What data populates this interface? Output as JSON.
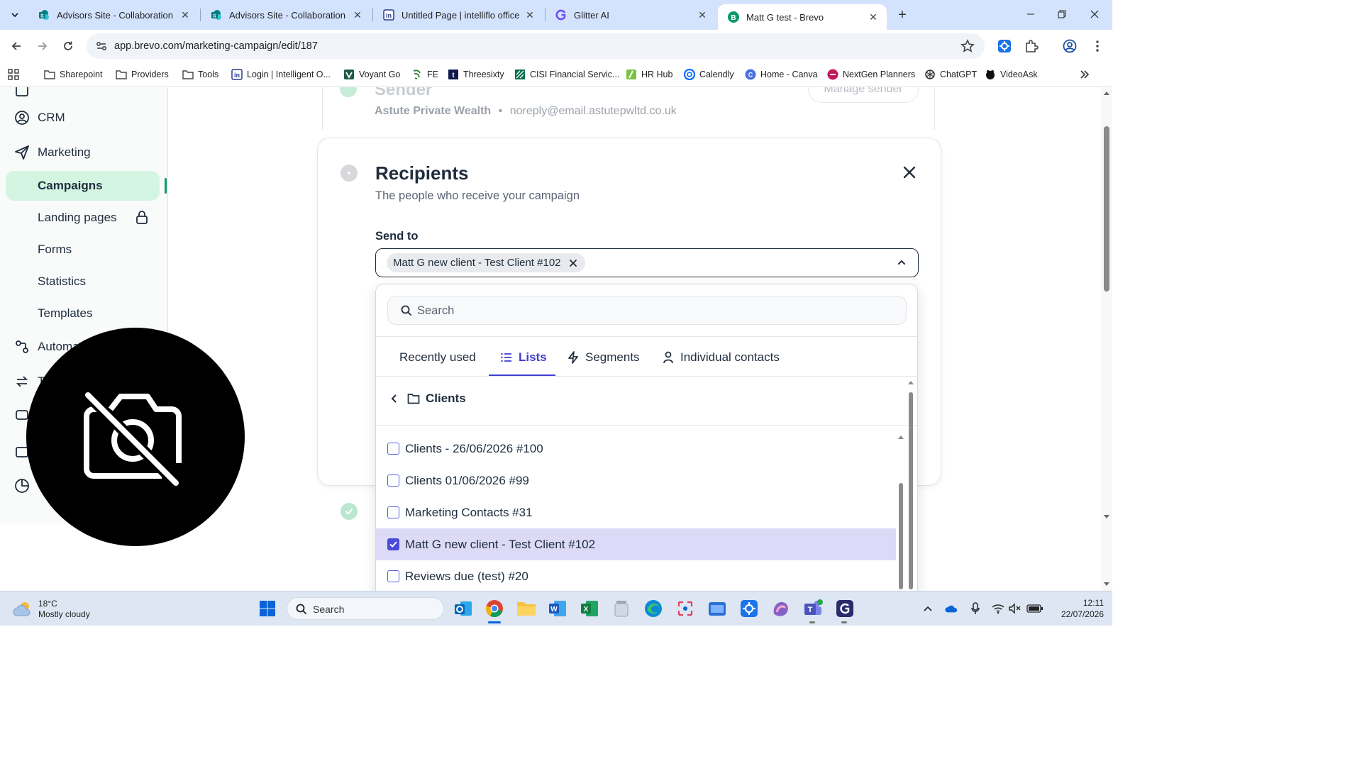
{
  "browser": {
    "tabs": [
      {
        "title": "Advisors Site - Collaboration Sit"
      },
      {
        "title": "Advisors Site - Collaboration Sit"
      },
      {
        "title": "Untitled Page | intelliflo office"
      },
      {
        "title": "Glitter AI"
      },
      {
        "title": "Matt G test - Brevo"
      }
    ],
    "url": "app.brevo.com/marketing-campaign/edit/187",
    "bookmarks": [
      {
        "label": "Sharepoint"
      },
      {
        "label": "Providers"
      },
      {
        "label": "Tools"
      },
      {
        "label": "Login | Intelligent O..."
      },
      {
        "label": "Voyant Go"
      },
      {
        "label": "FE"
      },
      {
        "label": "Threesixty"
      },
      {
        "label": "CISI Financial Servic..."
      },
      {
        "label": "HR Hub"
      },
      {
        "label": "Calendly"
      },
      {
        "label": "Home - Canva"
      },
      {
        "label": "NextGen Planners"
      },
      {
        "label": "ChatGPT"
      },
      {
        "label": "VideoAsk"
      }
    ]
  },
  "sidebar": {
    "items": [
      {
        "label": "CRM"
      },
      {
        "label": "Marketing"
      },
      {
        "label": "Campaigns"
      },
      {
        "label": "Landing pages"
      },
      {
        "label": "Forms"
      },
      {
        "label": "Statistics"
      },
      {
        "label": "Templates"
      },
      {
        "label": "Automa"
      },
      {
        "label": "T"
      }
    ]
  },
  "sender": {
    "title": "Sender",
    "name": "Astute Private Wealth",
    "separator": "•",
    "email": "noreply@email.astutepwltd.co.uk",
    "manage_label": "Manage sender"
  },
  "recipients": {
    "title": "Recipients",
    "subtitle": "The people who receive your campaign",
    "send_to_label": "Send to",
    "selected_chip": "Matt G new client - Test Client #102",
    "search_placeholder": "Search",
    "tabs": [
      {
        "label": "Recently used"
      },
      {
        "label": "Lists"
      },
      {
        "label": "Segments"
      },
      {
        "label": "Individual contacts"
      }
    ],
    "active_tab": "Lists",
    "folder": "Clients",
    "lists": [
      {
        "label": "Clients - 26/06/2026 #100",
        "checked": false
      },
      {
        "label": "Clients 01/06/2026 #99",
        "checked": false
      },
      {
        "label": "Marketing Contacts #31",
        "checked": false
      },
      {
        "label": "Matt G new client - Test Client #102",
        "checked": true
      },
      {
        "label": "Reviews due (test) #20",
        "checked": false
      }
    ]
  },
  "taskbar": {
    "weather_temp": "18°C",
    "weather_desc": "Mostly cloudy",
    "search_label": "Search",
    "time": "12:11",
    "date": "22/07/2026"
  },
  "colors": {
    "accent_purple": "#3e3ccf",
    "active_nav_bg": "#d5f5e3",
    "selected_row_bg": "#dcdaf6"
  }
}
